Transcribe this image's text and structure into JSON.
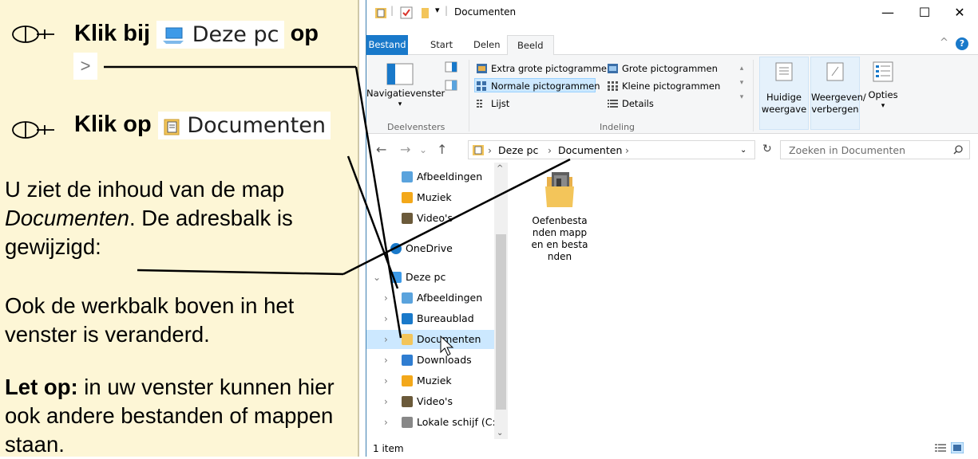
{
  "instructions": {
    "step1_prefix": "Klik bij",
    "step1_inline": "Deze pc",
    "step1_suffix": "op",
    "step1_chevron": ">",
    "step2_prefix": "Klik op",
    "step2_inline": "Documenten",
    "para1_a": "U ziet de inhoud van de map ",
    "para1_italic": "Documenten",
    "para1_b": ". De adresbalk is gewijzigd:",
    "para2": "Ook de werkbalk boven in het venster is veranderd.",
    "note_bold": "Let op:",
    "note_rest": " in uw venster kunnen hier ook andere bestanden of mappen staan."
  },
  "window": {
    "title": "Documenten",
    "minimize": "—",
    "maximize": "☐",
    "close": "✕",
    "help": "?",
    "collapse": "^"
  },
  "tabs": [
    "Bestand",
    "Start",
    "Delen",
    "Beeld"
  ],
  "ribbon": {
    "nav_pane_button": "Navigatievenster",
    "group_panes": "Deelvensters",
    "layout_items": [
      "Extra grote pictogrammen",
      "Grote pictogrammen",
      "Normale pictogrammen",
      "Kleine pictogrammen",
      "Lijst",
      "Details"
    ],
    "group_layout": "Indeling",
    "current_view": "Huidige weergave",
    "show_hide": "Weergeven/ verbergen",
    "options": "Opties"
  },
  "address": {
    "crumb1": "Deze pc",
    "crumb2": "Documenten",
    "search_placeholder": "Zoeken in Documenten"
  },
  "nav_items": [
    {
      "label": "Afbeeldingen",
      "icon": "pictures-icon"
    },
    {
      "label": "Muziek",
      "icon": "music-icon"
    },
    {
      "label": "Video's",
      "icon": "video-icon"
    },
    {
      "label": "OneDrive",
      "icon": "onedrive-icon"
    },
    {
      "label": "Deze pc",
      "icon": "this-pc-icon"
    },
    {
      "label": "Afbeeldingen",
      "icon": "pictures-icon"
    },
    {
      "label": "Bureaublad",
      "icon": "desktop-icon"
    },
    {
      "label": "Documenten",
      "icon": "documents-icon"
    },
    {
      "label": "Downloads",
      "icon": "downloads-icon"
    },
    {
      "label": "Muziek",
      "icon": "music-icon"
    },
    {
      "label": "Video's",
      "icon": "video-icon"
    },
    {
      "label": "Lokale schijf (C:)",
      "icon": "local-disk-icon"
    }
  ],
  "content": {
    "folder_name": "Oefenbestanden mappen en bestanden"
  },
  "status": {
    "item_count": "1 item"
  },
  "colors": {
    "panel_bg": "#fdf6d6",
    "accent_blue": "#1979ca",
    "selection": "#cce8ff"
  }
}
